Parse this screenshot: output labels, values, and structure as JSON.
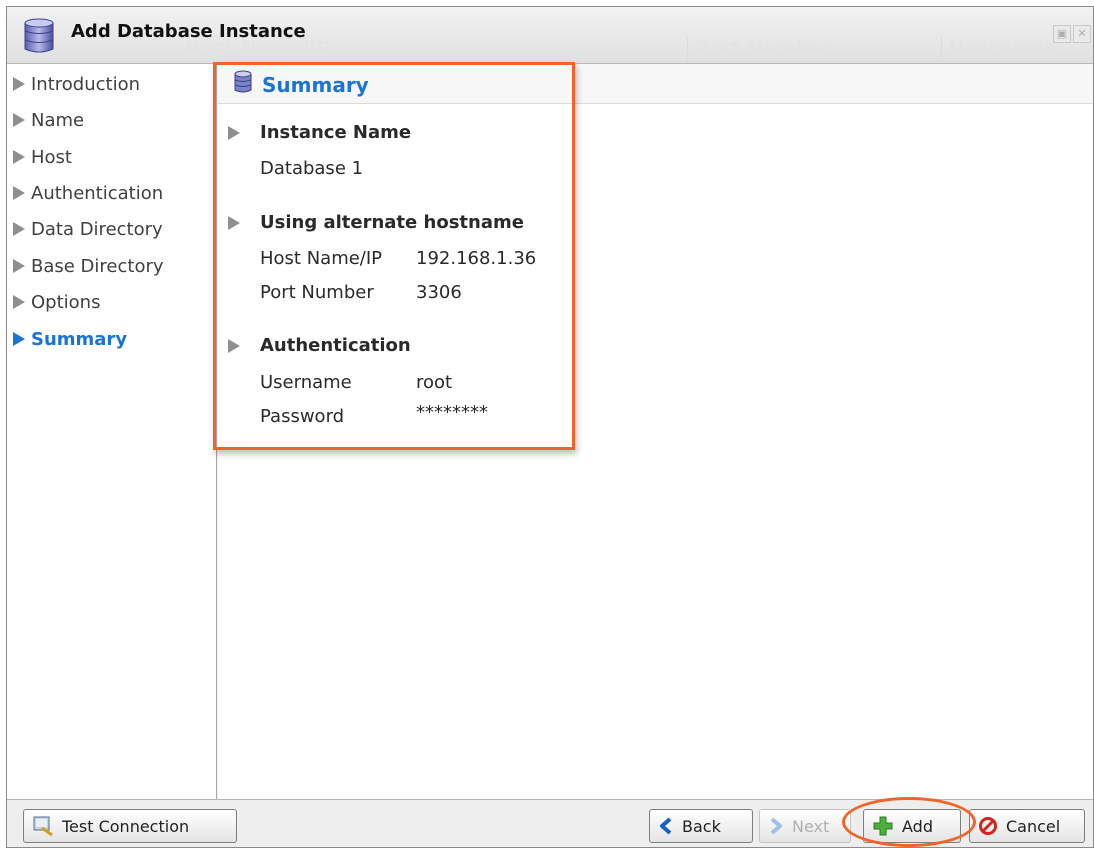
{
  "window": {
    "title": "Add Database Instance",
    "ghost_columns": [
      "Host Name/IP",
      "Port Number",
      "Username"
    ]
  },
  "sidebar": {
    "items": [
      {
        "label": "Introduction",
        "active": false
      },
      {
        "label": "Name",
        "active": false
      },
      {
        "label": "Host",
        "active": false
      },
      {
        "label": "Authentication",
        "active": false
      },
      {
        "label": "Data Directory",
        "active": false
      },
      {
        "label": "Base Directory",
        "active": false
      },
      {
        "label": "Options",
        "active": false
      },
      {
        "label": "Summary",
        "active": true
      }
    ]
  },
  "summary": {
    "title": "Summary",
    "instance": {
      "heading": "Instance Name",
      "value": "Database 1"
    },
    "host": {
      "heading": "Using alternate hostname",
      "host_label": "Host Name/IP",
      "host_value": "192.168.1.36",
      "port_label": "Port Number",
      "port_value": "3306"
    },
    "auth": {
      "heading": "Authentication",
      "username_label": "Username",
      "username_value": "root",
      "password_label": "Password",
      "password_value": "********"
    }
  },
  "footer": {
    "test_connection": "Test Connection",
    "back": "Back",
    "next": "Next",
    "add": "Add",
    "cancel": "Cancel"
  },
  "colors": {
    "accent": "#1a74d6",
    "highlight": "#f0642a"
  }
}
